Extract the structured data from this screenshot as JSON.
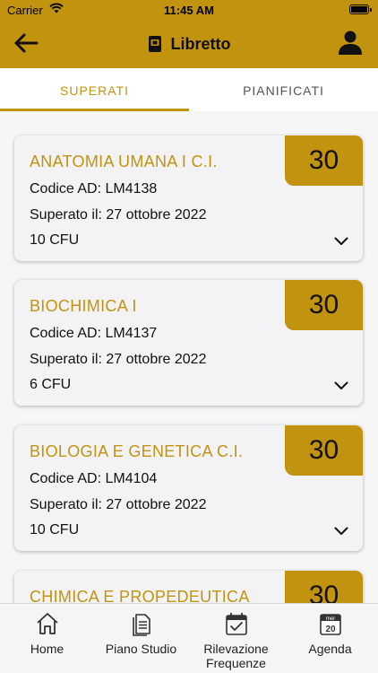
{
  "status_bar": {
    "carrier": "Carrier",
    "time": "11:45 AM"
  },
  "header": {
    "title": "Libretto"
  },
  "tabs": [
    {
      "label": "SUPERATI",
      "active": true
    },
    {
      "label": "PIANIFICATI",
      "active": false
    }
  ],
  "exams": [
    {
      "title": "ANATOMIA UMANA I C.I.",
      "code": "Codice AD: LM4138",
      "date": "Superato il: 27 ottobre 2022",
      "cfu": "10 CFU",
      "grade": "30"
    },
    {
      "title": "BIOCHIMICA I",
      "code": "Codice AD: LM4137",
      "date": "Superato il: 27 ottobre 2022",
      "cfu": "6 CFU",
      "grade": "30"
    },
    {
      "title": "BIOLOGIA E GENETICA C.I.",
      "code": "Codice AD: LM4104",
      "date": "Superato il: 27 ottobre 2022",
      "cfu": "10 CFU",
      "grade": "30"
    },
    {
      "title": "CHIMICA E PROPEDEUTICA",
      "grade": "30"
    }
  ],
  "bottom_nav": [
    {
      "label": "Home",
      "icon": "home-icon"
    },
    {
      "label": "Piano Studio",
      "icon": "document-icon"
    },
    {
      "label_line1": "Rilevazione",
      "label_line2": "Frequenze",
      "icon": "calendar-check-icon"
    },
    {
      "label": "Agenda",
      "icon": "calendar-icon",
      "calendar_day": "mer",
      "calendar_date": "20"
    }
  ],
  "colors": {
    "accent": "#c1930f",
    "card_bg": "#f3f3f5",
    "list_bg": "#f6f6f7"
  }
}
